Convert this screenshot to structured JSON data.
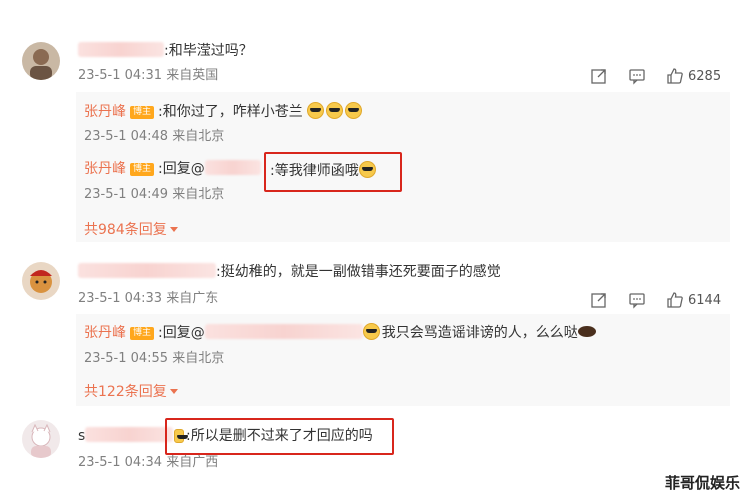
{
  "comments": [
    {
      "text": ":和毕滢过吗？",
      "time": "23-5-1 04:31",
      "location": "来自英国",
      "likes": "6285",
      "replies": [
        {
          "name": "张丹峰",
          "badge": "博主",
          "text": ":和你过了，咋样小苍兰",
          "time": "23-5-1 04:48",
          "location": "来自北京"
        },
        {
          "name": "张丹峰",
          "badge": "博主",
          "prefix": ":回复@",
          "text": ":等我律师函哦",
          "time": "23-5-1 04:49",
          "location": "来自北京"
        }
      ],
      "more": "共984条回复"
    },
    {
      "text": ":挺幼稚的，就是一副做错事还死要面子的感觉",
      "time": "23-5-1 04:33",
      "location": "来自广东",
      "likes": "6144",
      "replies": [
        {
          "name": "张丹峰",
          "badge": "博主",
          "prefix": ":回复@",
          "text": "我只会骂造谣诽谤的人，么么哒",
          "time": "23-5-1 04:55",
          "location": "来自北京"
        }
      ],
      "more": "共122条回复"
    },
    {
      "name_initial": "s",
      "text": ":所以是删不过来了才回应的吗",
      "time": "23-5-1 04:34",
      "location": "来自广西"
    }
  ],
  "icons": {
    "share": "share-icon",
    "comment": "comment-icon",
    "like": "thumbs-up-icon"
  },
  "colors": {
    "name_orange": "#eb7350",
    "highlight_box": "#d8261c",
    "badge": "#ffa71c"
  },
  "watermark": "菲哥侃娱乐"
}
